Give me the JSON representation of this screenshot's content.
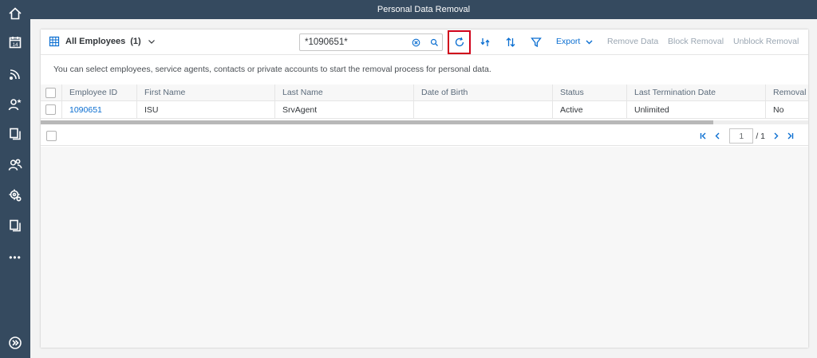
{
  "shell": {
    "title": "Personal Data Removal"
  },
  "sidebar": {
    "items": [
      {
        "icon": "home-icon"
      },
      {
        "icon": "calendar-icon",
        "label": "14"
      },
      {
        "icon": "feed-icon"
      },
      {
        "icon": "user-favorite-icon"
      },
      {
        "icon": "copy-icon"
      },
      {
        "icon": "users-icon"
      },
      {
        "icon": "user-settings-icon"
      },
      {
        "icon": "copy-icon"
      },
      {
        "icon": "more-icon",
        "label": "•••"
      },
      {
        "icon": "expand-icon"
      }
    ]
  },
  "toolbar": {
    "variant_title": "All Employees",
    "variant_count": "(1)",
    "search_value": "*1090651*",
    "export_label": "Export",
    "remove_data_label": "Remove Data",
    "block_removal_label": "Block Removal",
    "unblock_removal_label": "Unblock Removal"
  },
  "info_text": "You can select employees, service agents, contacts or private accounts to start the removal process for personal data.",
  "table": {
    "columns": [
      "Employee ID",
      "First Name",
      "Last Name",
      "Date of Birth",
      "Status",
      "Last Termination Date",
      "Removal B"
    ],
    "rows": [
      [
        "1090651",
        "ISU",
        "SrvAgent",
        "",
        "Active",
        "Unlimited",
        "No"
      ]
    ]
  },
  "pager": {
    "current_page": "1",
    "total_label": "/ 1"
  },
  "colors": {
    "shell": "#354a5f",
    "accent": "#0a6ed1",
    "highlight": "#d0021b"
  }
}
